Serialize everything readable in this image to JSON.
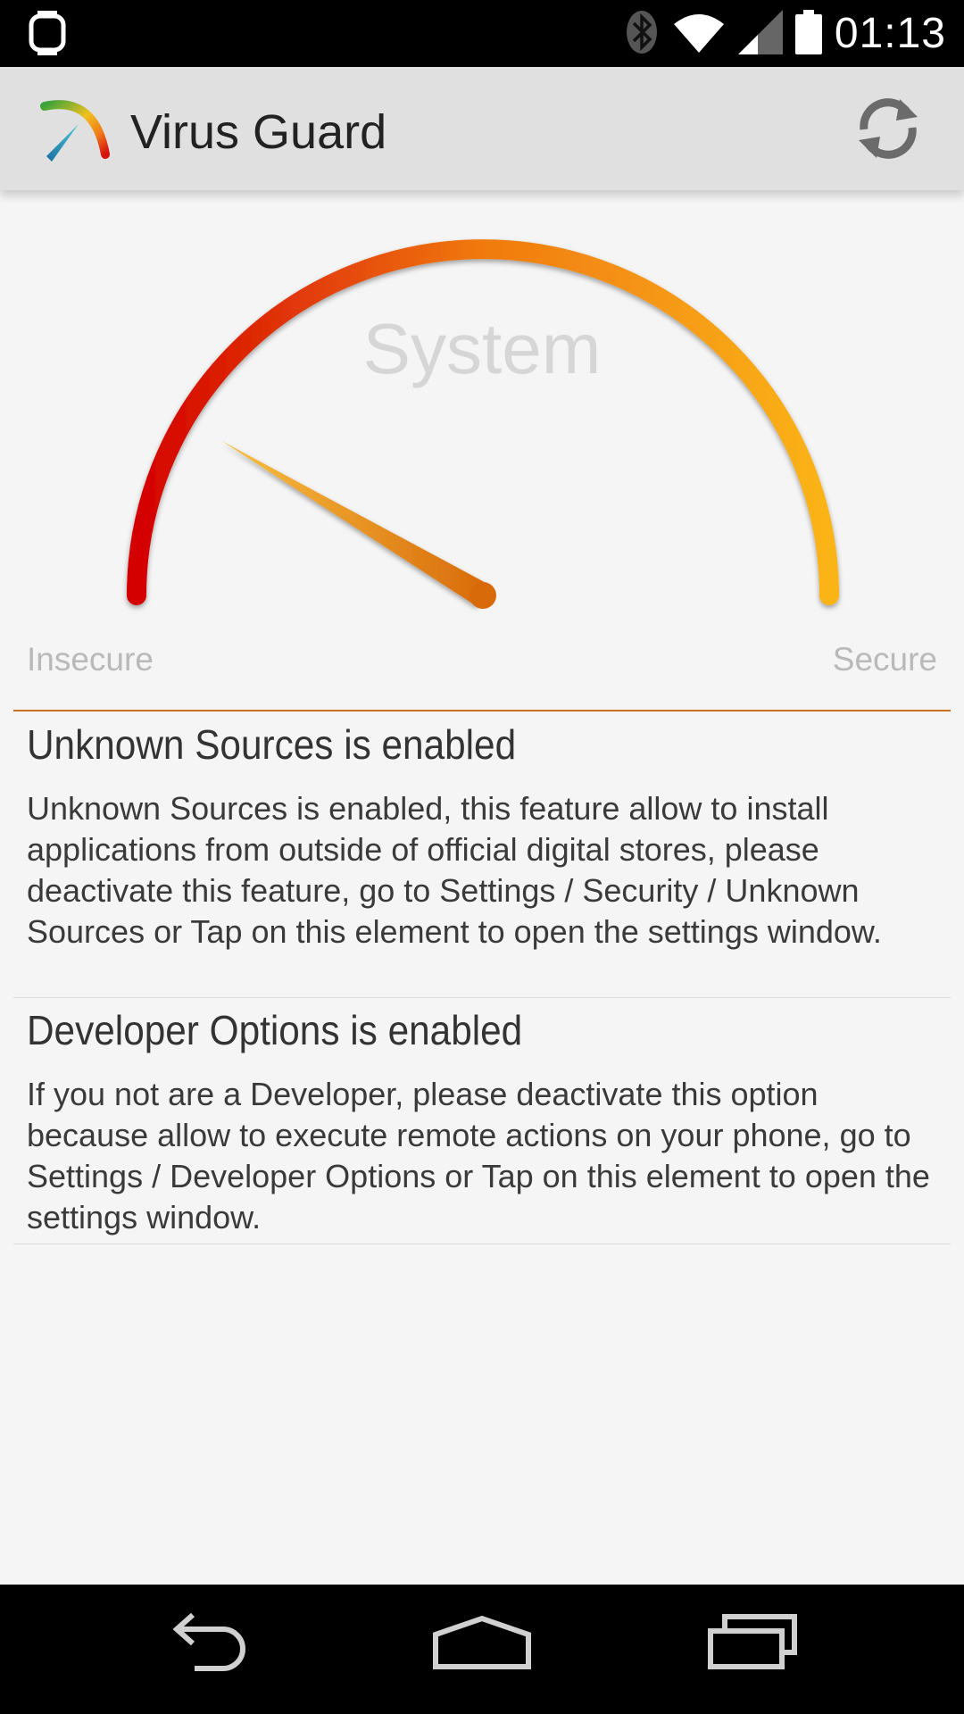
{
  "status_bar": {
    "time": "01:13",
    "icons": [
      "android-wear-icon",
      "bluetooth-icon",
      "wifi-icon",
      "signal-icon",
      "battery-icon"
    ]
  },
  "app_bar": {
    "title": "Virus Guard",
    "logo_icon": "gauge-logo-icon",
    "refresh_icon": "refresh-icon"
  },
  "gauge": {
    "caption": "System",
    "left_label": "Insecure",
    "right_label": "Secure",
    "security_level": 0.17,
    "colors": {
      "low": "#d40000",
      "mid": "#f07a10",
      "high": "#fbb417",
      "needle": "#f09a1a"
    }
  },
  "issues": [
    {
      "title": "Unknown Sources is enabled",
      "description": "Unknown Sources is enabled, this feature allow to install applications from outside of official digital stores, please deactivate this feature, go to Settings / Security / Unknown Sources or Tap on this element to open the settings window."
    },
    {
      "title": "Developer Options is enabled",
      "description": "If you not are a Developer, please deactivate this option because allow to execute remote actions on your phone, go to Settings / Developer Options or Tap on this element to open the settings window."
    }
  ],
  "nav_bar": {
    "buttons": [
      "back-icon",
      "home-icon",
      "recents-icon"
    ]
  },
  "colors": {
    "accent_divider": "#c8711c",
    "background": "#f5f5f5"
  }
}
